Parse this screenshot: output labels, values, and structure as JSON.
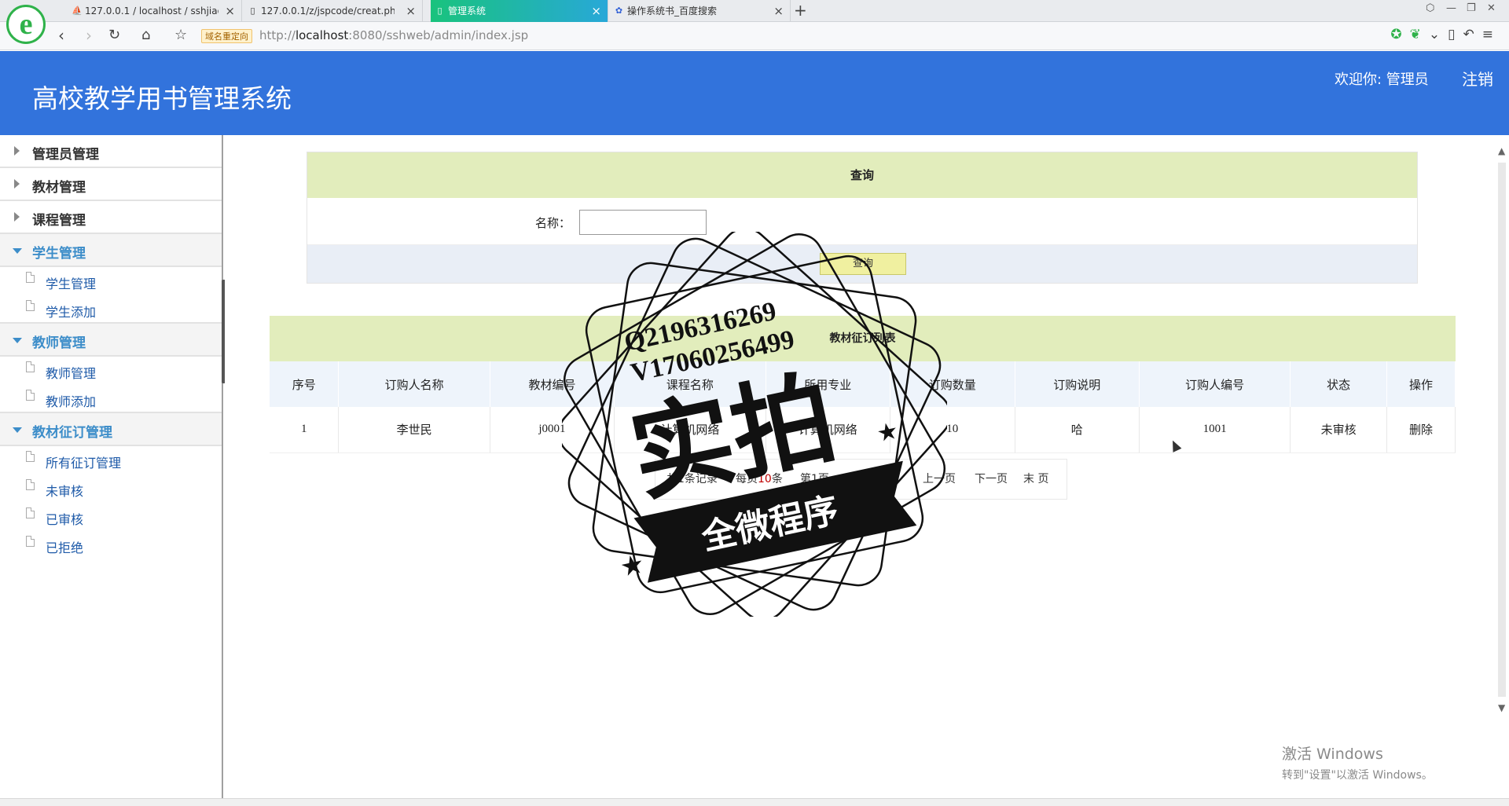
{
  "browser": {
    "tabs": [
      {
        "favicon": "pma-icon",
        "title": "127.0.0.1 / localhost / sshjiao"
      },
      {
        "favicon": "page-icon",
        "title": "127.0.0.1/z/jspcode/creat.php"
      },
      {
        "favicon": "page-icon",
        "title": "管理系统"
      },
      {
        "favicon": "baidu-icon",
        "title": "操作系统书_百度搜索"
      }
    ],
    "redirect_badge": "域名重定向",
    "url_prefix": "http://",
    "url_host": "localhost",
    "url_rest": ":8080/sshweb/admin/index.jsp"
  },
  "header": {
    "title": "高校教学用书管理系统",
    "welcome": "欢迎你: 管理员",
    "logout": "注销"
  },
  "sidebar": {
    "groups": [
      {
        "label": "管理员管理",
        "open": false,
        "items": []
      },
      {
        "label": "教材管理",
        "open": false,
        "items": []
      },
      {
        "label": "课程管理",
        "open": false,
        "items": []
      },
      {
        "label": "学生管理",
        "open": true,
        "items": [
          "学生管理",
          "学生添加"
        ]
      },
      {
        "label": "教师管理",
        "open": true,
        "items": [
          "教师管理",
          "教师添加"
        ]
      },
      {
        "label": "教材征订管理",
        "open": true,
        "items": [
          "所有征订管理",
          "未审核",
          "已审核",
          "已拒绝"
        ]
      }
    ]
  },
  "query": {
    "title": "查询",
    "name_label": "名称：",
    "name_value": "",
    "button": "查询"
  },
  "list": {
    "title": "教材征订列表",
    "columns": [
      "序号",
      "订购人名称",
      "教材编号",
      "课程名称",
      "所用专业",
      "订购数量",
      "订购说明",
      "订购人编号",
      "状态",
      "操作"
    ],
    "rows": [
      [
        "1",
        "李世民",
        "j0001",
        "计算机网络",
        "计算机网络",
        "10",
        "哈",
        "1001",
        "未审核",
        "删除"
      ]
    ]
  },
  "pager": {
    "total": "共1条记录",
    "per_page_prefix": "每页",
    "per_page_value": "10",
    "per_page_suffix": "条",
    "page_info": "第1页",
    "first": "首页",
    "prev": "上一页",
    "next": "下一页",
    "last": "末 页"
  },
  "watermark": {
    "line1": "Q2196316269",
    "line2": "V17060256499",
    "big": "实拍",
    "banner": "全微程序"
  },
  "windows": {
    "line1": "激活 Windows",
    "line2": "转到\"设置\"以激活 Windows。"
  }
}
